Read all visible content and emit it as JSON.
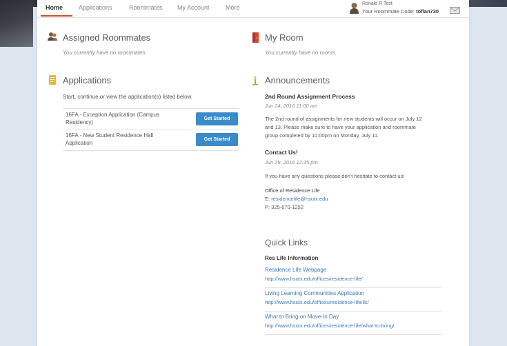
{
  "nav": {
    "tabs": [
      "Home",
      "Applications",
      "Roommates",
      "My Account",
      "More"
    ],
    "active": "Home"
  },
  "user": {
    "name": "Ronald R Test",
    "code_label": "Your Roommate Code:",
    "code": "toflan730"
  },
  "roommates": {
    "title": "Assigned Roommates",
    "empty_text": "You currently have no roommates."
  },
  "applications": {
    "title": "Applications",
    "intro": "Start, continue or view the application(s) listed below.",
    "items": [
      {
        "name_line1": "16FA - Exception Application (Campus",
        "name_line2": "Residency)",
        "button": "Get Started"
      },
      {
        "name_line1": "16FA - New Student Residence Hall",
        "name_line2": "Application",
        "button": "Get Started"
      }
    ]
  },
  "my_room": {
    "title": "My Room",
    "empty_text": "You currently have no rooms."
  },
  "announcements": {
    "title": "Announcements",
    "items": [
      {
        "title": "2nd Round Assignment Process",
        "date": "Jun 24, 2016 11:00 am",
        "body_lines": [
          "The 2nd round of assignments for new students will occur on July 12",
          "and 13. Please make sure to have your application and roommate",
          "group completed by 10:00pm on Monday, July 11."
        ]
      },
      {
        "title": "Contact Us!",
        "date": "Jun 29, 2016 12:35 pm",
        "body_lines": [
          "If you have any questions please don't hesitate to contact us!"
        ]
      }
    ],
    "office": {
      "name": "Office of Residence Life",
      "email_label": "E:",
      "email": "residencelife@hsutx.edu",
      "phone": "P: 325-670-1252"
    }
  },
  "quick_links": {
    "title": "Quick Links",
    "subtitle": "Res Life Information",
    "items": [
      {
        "name": "Residence Life Webpage",
        "url": "http://www.hsutx.edu/offices/residence-life/"
      },
      {
        "name": "Living Learning Communities Application",
        "url": "http://www.hsutx.edu/offices/residence-life/llc/"
      },
      {
        "name": "What to Bring on Move-In Day",
        "url": "http://www.hsutx.edu/offices/residence-life/what-to-bring/"
      }
    ]
  },
  "colors": {
    "accent": "#c8512a",
    "button": "#3a8bc9",
    "link": "#3a78b8",
    "page_bg": "#dde6ef"
  },
  "icons": [
    "roommates-icon",
    "applications-icon",
    "my-room-icon",
    "announcements-icon",
    "user-avatar-icon",
    "mail-icon"
  ]
}
